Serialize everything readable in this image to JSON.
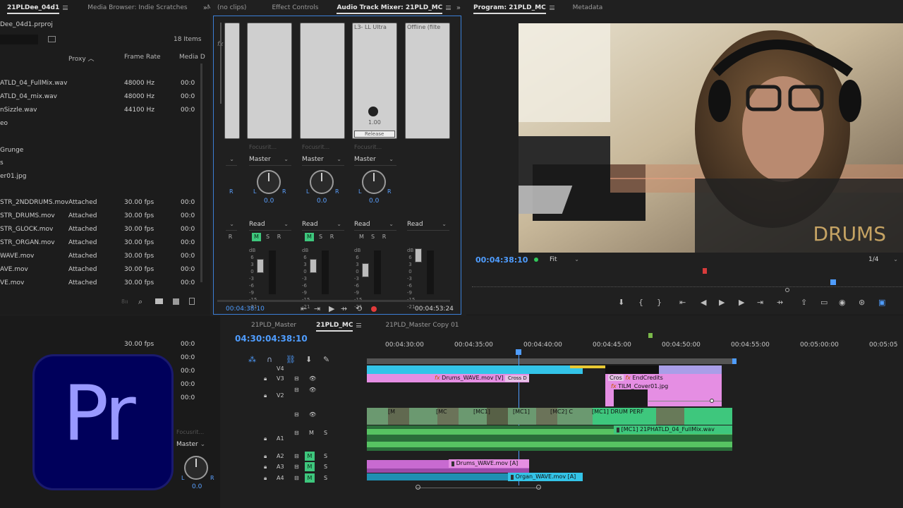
{
  "project_panel": {
    "tabs": [
      "21PLDee_04d1",
      "Media Browser: Indie Scratches",
      "Media"
    ],
    "project_file": "Dee_04d1.prproj",
    "items_count": "18 Items",
    "columns": [
      "Proxy",
      "Frame Rate",
      "Media D"
    ],
    "rows": [
      {
        "name": "ATLD_04_FullMix.wav",
        "proxy": "",
        "rate": "48000 Hz",
        "media": "00:0"
      },
      {
        "name": "ATLD_04_mix.wav",
        "proxy": "",
        "rate": "48000 Hz",
        "media": "00:0"
      },
      {
        "name": "nSizzle.wav",
        "proxy": "",
        "rate": "44100 Hz",
        "media": "00:0"
      },
      {
        "name": "eo",
        "proxy": "",
        "rate": "",
        "media": ""
      },
      {
        "name": "",
        "proxy": "",
        "rate": "",
        "media": ""
      },
      {
        "name": "Grunge",
        "proxy": "",
        "rate": "",
        "media": ""
      },
      {
        "name": "s",
        "proxy": "",
        "rate": "",
        "media": ""
      },
      {
        "name": "er01.jpg",
        "proxy": "",
        "rate": "",
        "media": ""
      },
      {
        "name": "",
        "proxy": "",
        "rate": "",
        "media": ""
      },
      {
        "name": "STR_2NDDRUMS.mov",
        "proxy": "Attached",
        "rate": "30.00 fps",
        "media": "00:0"
      },
      {
        "name": "STR_DRUMS.mov",
        "proxy": "Attached",
        "rate": "30.00 fps",
        "media": "00:0"
      },
      {
        "name": "STR_GLOCK.mov",
        "proxy": "Attached",
        "rate": "30.00 fps",
        "media": "00:0"
      },
      {
        "name": "STR_ORGAN.mov",
        "proxy": "Attached",
        "rate": "30.00 fps",
        "media": "00:0"
      },
      {
        "name": "WAVE.mov",
        "proxy": "Attached",
        "rate": "30.00 fps",
        "media": "00:0"
      },
      {
        "name": "AVE.mov",
        "proxy": "Attached",
        "rate": "30.00 fps",
        "media": "00:0"
      },
      {
        "name": "VE.mov",
        "proxy": "Attached",
        "rate": "30.00 fps",
        "media": "00:0"
      }
    ],
    "lower_rows": [
      {
        "rate": "30.00 fps",
        "media": "00:0"
      },
      {
        "rate": "",
        "media": "00:0"
      },
      {
        "rate": "",
        "media": "00:0"
      },
      {
        "rate": "",
        "media": "00:0"
      },
      {
        "rate": "",
        "media": "00:0"
      }
    ]
  },
  "mixer": {
    "tabs": [
      "(no clips)",
      "Effect Controls",
      "Audio Track Mixer: 21PLD_MC"
    ],
    "strip_labels": [
      "",
      "",
      "",
      "L3- LL Ultra",
      "Offline (filte"
    ],
    "knob_label": "1.00",
    "release": "Release",
    "inputs": [
      "Focusrit...",
      "Focusrit...",
      "Focusrit..."
    ],
    "outputs": [
      "Master",
      "Master",
      "Master"
    ],
    "pan_values": [
      "0.0",
      "0.0",
      "0.0"
    ],
    "modes": [
      "Read",
      "Read",
      "Read",
      "Read"
    ],
    "msr": [
      "M",
      "S",
      "R"
    ],
    "scale": "dB\n 6\n 3\n 0\n-3\n-6\n-9\n-15\n-21",
    "time_left": "00:04:38:10",
    "time_right": "00:04:53:24"
  },
  "program": {
    "tabs": [
      "Program: 21PLD_MC",
      "Metadata"
    ],
    "overlay_text": "DRUMS",
    "timecode": "00:04:38:10",
    "fit": "Fit",
    "quality": "1/4"
  },
  "timeline": {
    "tabs": [
      "21PLD_Master",
      "21PLD_MC",
      "21PLD_Master Copy 01"
    ],
    "timecode": "04:30:04:38:10",
    "ruler": [
      "00:04:30:00",
      "00:04:35:00",
      "00:04:40:00",
      "00:04:45:00",
      "00:04:50:00",
      "00:04:55:00",
      "00:05:00:00",
      "00:05:05"
    ],
    "tracks": [
      "V4",
      "V3",
      "V2",
      "A1",
      "A2",
      "A3",
      "A4"
    ],
    "clips": {
      "drums_v": "Drums_WAVE.mov [V]",
      "cross": "Cross D",
      "end_credits": "EndCredits",
      "cross2": "Cros",
      "cover": "TILM_Cover01.jpg",
      "mc": [
        "[M",
        "[MC",
        "[MC1]",
        "[MC1]",
        "[MC2] C",
        "[MC1] DRUM PERF"
      ],
      "fullmix": "[MC1] 21PHATLD_04_FullMix.wav",
      "drums_a": "Drums_WAVE.mov [A]",
      "organ_a": "Organ_WAVE.mov [A]"
    },
    "mini_output": "Master",
    "mini_input": "Focusrit...",
    "mini_val": "0.0"
  },
  "logo": {
    "text": "Pr"
  }
}
